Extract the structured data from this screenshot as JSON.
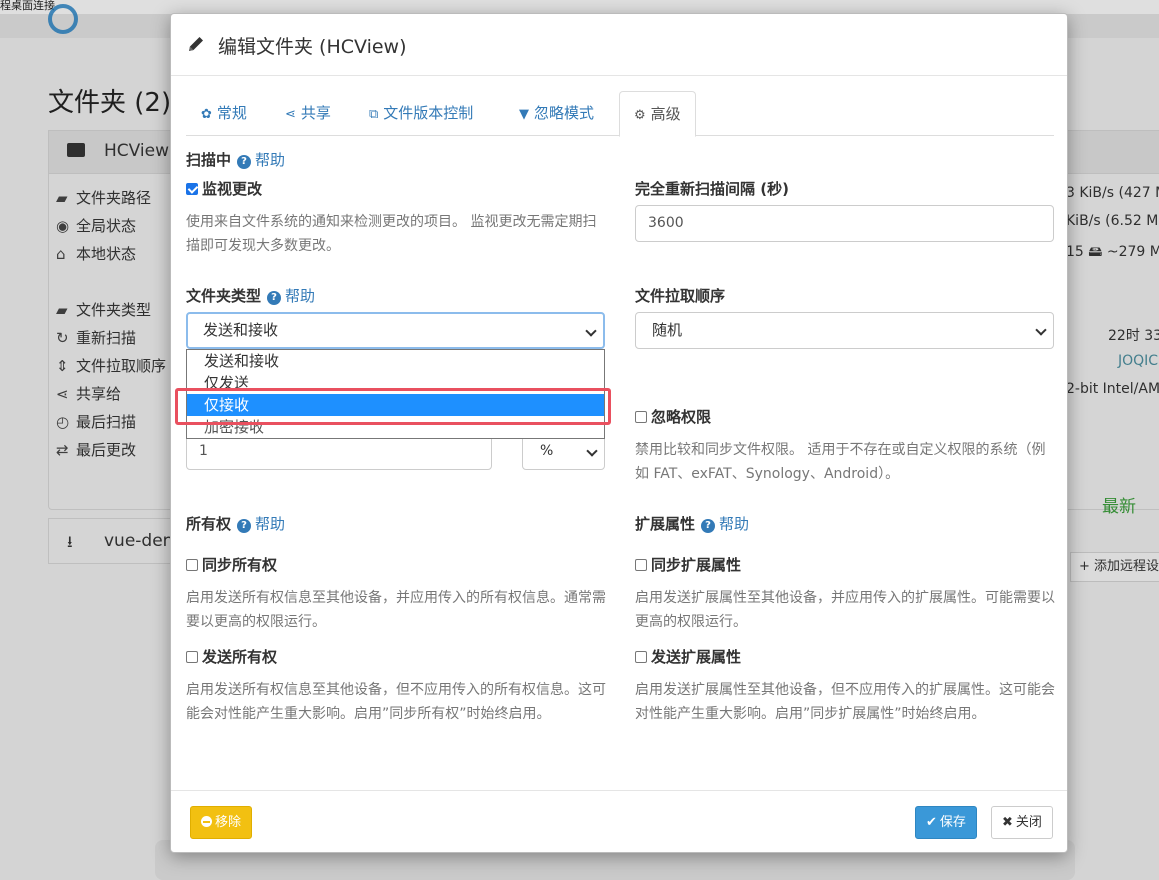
{
  "background": {
    "top_strip_text": "程桌面连接",
    "page_title": "文件夹 (2)",
    "folder_name": "HCView",
    "rows": [
      {
        "icon": "folder-open-icon",
        "glyph": "▰",
        "label": "文件夹路径"
      },
      {
        "icon": "globe-icon",
        "glyph": "◉",
        "label": "全局状态"
      },
      {
        "icon": "home-icon",
        "glyph": "⌂",
        "label": "本地状态"
      },
      {
        "icon": "blank",
        "glyph": "",
        "label": ""
      },
      {
        "icon": "folder-icon",
        "glyph": "▰",
        "label": "文件夹类型"
      },
      {
        "icon": "refresh-icon",
        "glyph": "↻",
        "label": "重新扫描"
      },
      {
        "icon": "sort-icon",
        "glyph": "⇕",
        "label": "文件拉取顺序"
      },
      {
        "icon": "share-icon",
        "glyph": "⋖",
        "label": "共享给"
      },
      {
        "icon": "clock-icon",
        "glyph": "◴",
        "label": "最后扫描"
      },
      {
        "icon": "exchange-icon",
        "glyph": "⇄",
        "label": "最后更改"
      }
    ],
    "right_col": [
      "3 KiB/s (427 M",
      "KiB/s (6.52 M",
      "15   🖴 ~279 M",
      "22时 33",
      "JOQIC",
      "2-bit Intel/AM"
    ],
    "latest_label": "最新",
    "second_folder": "vue-den",
    "add_remote": "添加远程设"
  },
  "modal": {
    "title": "编辑文件夹 (HCView)",
    "tabs": [
      {
        "icon": "gear-icon",
        "glyph": "✿",
        "label": "常规"
      },
      {
        "icon": "share-icon",
        "glyph": "⋖",
        "label": "共享"
      },
      {
        "icon": "copy-icon",
        "glyph": "⧉",
        "label": "文件版本控制"
      },
      {
        "icon": "filter-icon",
        "glyph": "▼",
        "label": "忽略模式"
      },
      {
        "icon": "cogs-icon",
        "glyph": "⚙",
        "label": "高级"
      }
    ],
    "help_label": "帮助",
    "scanning": {
      "title": "扫描中",
      "watch_label": "监视更改",
      "watch_checked": true,
      "watch_desc": "使用来自文件系统的通知来检测更改的项目。 监视更改无需定期扫描即可发现大多数更改。",
      "rescan_title": "完全重新扫描间隔 (秒)",
      "rescan_value": "3600"
    },
    "folder_type": {
      "title": "文件夹类型",
      "selected": "发送和接收",
      "options": [
        "发送和接收",
        "仅发送",
        "仅接收",
        "加密接收"
      ],
      "highlighted_index": 2
    },
    "pull_order": {
      "title": "文件拉取顺序",
      "selected": "随机"
    },
    "min_disk": {
      "value": "1",
      "unit": "%"
    },
    "ignore_perms": {
      "label": "忽略权限",
      "checked": false,
      "desc": "禁用比较和同步文件权限。 适用于不存在或自定义权限的系统（例如 FAT、exFAT、Synology、Android）。"
    },
    "ownership": {
      "title": "所有权",
      "sync_label": "同步所有权",
      "sync_desc": "启用发送所有权信息至其他设备，并应用传入的所有权信息。通常需要以更高的权限运行。",
      "send_label": "发送所有权",
      "send_desc": "启用发送所有权信息至其他设备，但不应用传入的所有权信息。这可能会对性能产生重大影响。启用”同步所有权”时始终启用。"
    },
    "xattrs": {
      "title": "扩展属性",
      "sync_label": "同步扩展属性",
      "sync_desc": "启用发送扩展属性至其他设备，并应用传入的扩展属性。可能需要以更高的权限运行。",
      "send_label": "发送扩展属性",
      "send_desc": "启用发送扩展属性至其他设备，但不应用传入的扩展属性。这可能会对性能产生重大影响。启用”同步扩展属性”时始终启用。"
    },
    "footer": {
      "remove_label": "移除",
      "save_label": "保存",
      "close_label": "关闭"
    }
  },
  "colors": {
    "link_blue": "#337ab7",
    "warning_yellow": "#f2c011",
    "primary_blue": "#3a98d8",
    "highlight_red": "#e9505f",
    "dropdown_selected": "#1e90ff"
  }
}
